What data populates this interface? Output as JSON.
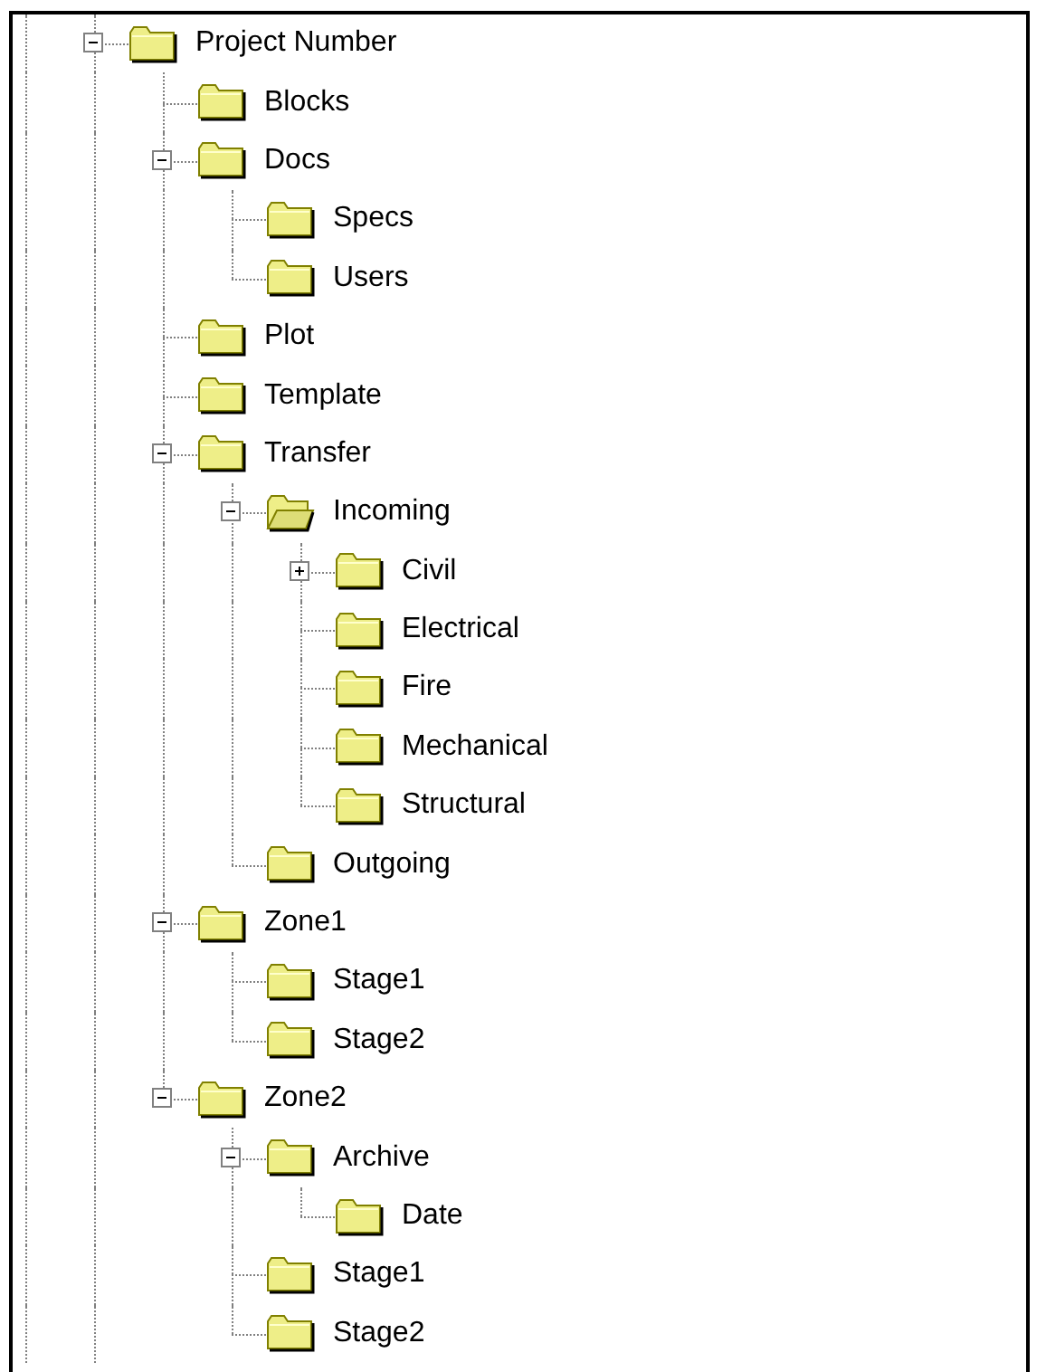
{
  "tree": {
    "items": [
      {
        "label": "Project Number",
        "kind": "folder",
        "expanded": true,
        "children": [
          {
            "label": "Blocks",
            "kind": "folder"
          },
          {
            "label": "Docs",
            "kind": "folder",
            "expanded": true,
            "children": [
              {
                "label": "Specs",
                "kind": "folder"
              },
              {
                "label": "Users",
                "kind": "folder"
              }
            ]
          },
          {
            "label": "Plot",
            "kind": "folder"
          },
          {
            "label": "Template",
            "kind": "folder"
          },
          {
            "label": "Transfer",
            "kind": "folder",
            "expanded": true,
            "children": [
              {
                "label": "Incoming",
                "kind": "open-folder",
                "expanded": true,
                "children": [
                  {
                    "label": "Civil",
                    "kind": "folder",
                    "expanded": false
                  },
                  {
                    "label": "Electrical",
                    "kind": "folder"
                  },
                  {
                    "label": "Fire",
                    "kind": "folder"
                  },
                  {
                    "label": "Mechanical",
                    "kind": "folder"
                  },
                  {
                    "label": "Structural",
                    "kind": "folder"
                  }
                ]
              },
              {
                "label": "Outgoing",
                "kind": "folder"
              }
            ]
          },
          {
            "label": "Zone1",
            "kind": "folder",
            "expanded": true,
            "children": [
              {
                "label": "Stage1",
                "kind": "folder"
              },
              {
                "label": "Stage2",
                "kind": "folder"
              }
            ]
          },
          {
            "label": "Zone2",
            "kind": "folder",
            "expanded": true,
            "children": [
              {
                "label": "Archive",
                "kind": "folder",
                "expanded": true,
                "children": [
                  {
                    "label": "Date",
                    "kind": "folder"
                  }
                ]
              },
              {
                "label": "Stage1",
                "kind": "folder"
              },
              {
                "label": "Stage2",
                "kind": "folder"
              }
            ]
          }
        ]
      }
    ]
  }
}
